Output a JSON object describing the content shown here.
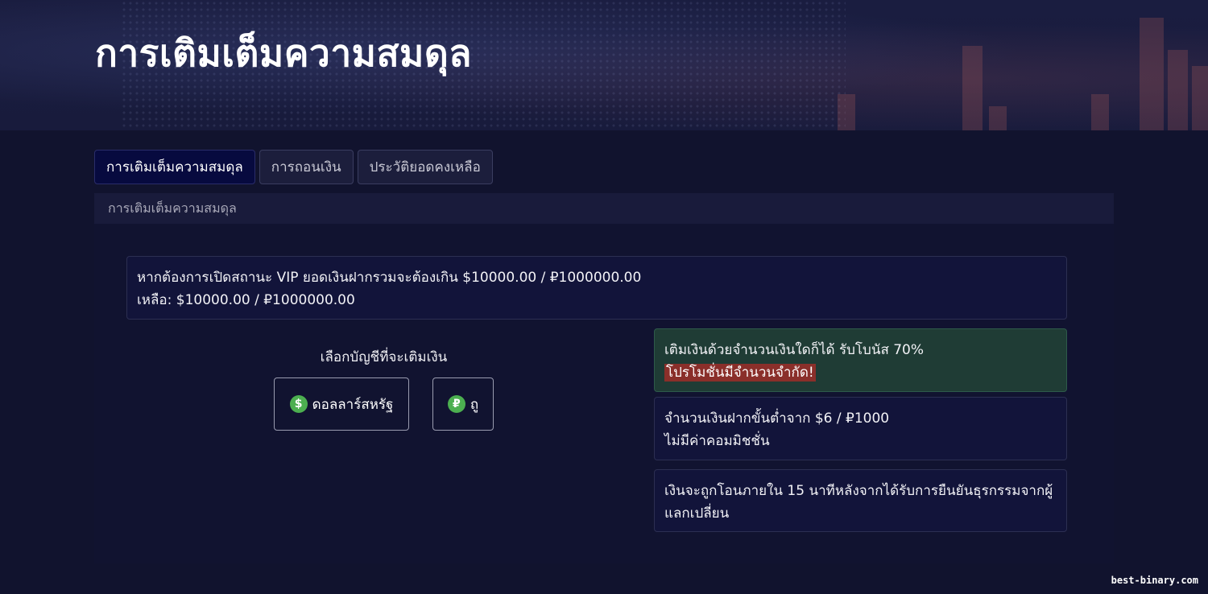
{
  "hero": {
    "title": "การเติมเต็มความสมดุล"
  },
  "watermark": "best-binary.com",
  "tabs": [
    {
      "label": "การเติมเต็มความสมดุล",
      "active": true
    },
    {
      "label": "การถอนเงิน",
      "active": false
    },
    {
      "label": "ประวัติยอดคงเหลือ",
      "active": false
    }
  ],
  "panel": {
    "header": "การเติมเต็มความสมดุล"
  },
  "vip": {
    "line1": "หากต้องการเปิดสถานะ VIP ยอดเงินฝากรวมจะต้องเกิน $10000.00 / ₽1000000.00",
    "line2": "เหลือ: $10000.00 / ₽1000000.00"
  },
  "account_select": {
    "label": "เลือกบัญชีที่จะเติมเงิน",
    "options": [
      {
        "icon": "dollar-coin-icon",
        "symbol": "$",
        "label": "ดอลลาร์สหรัฐ"
      },
      {
        "icon": "ruble-coin-icon",
        "symbol": "₽",
        "label": "ถู"
      }
    ]
  },
  "info": {
    "bonus": {
      "line1": "เติมเงินด้วยจำนวนเงินใดก็ได้ รับโบนัส 70%",
      "promo": "โปรโมชั่นมีจำนวนจำกัด!"
    },
    "minimum": {
      "line1": "จำนวนเงินฝากขั้นต่ำจาก $6 / ₽1000",
      "line2": "ไม่มีค่าคอมมิชชั่น"
    },
    "transfer": {
      "line1": "เงินจะถูกโอนภายใน 15 นาทีหลังจากได้รับการยืนยันธุรกรรมจากผู้แลกเปลี่ยน"
    }
  },
  "colors": {
    "background": "#11132e",
    "active_tab": "#070a3f",
    "bonus_box": "#1f3c35",
    "promo_tag": "#8a2f2a",
    "coin": "#4caf50"
  }
}
